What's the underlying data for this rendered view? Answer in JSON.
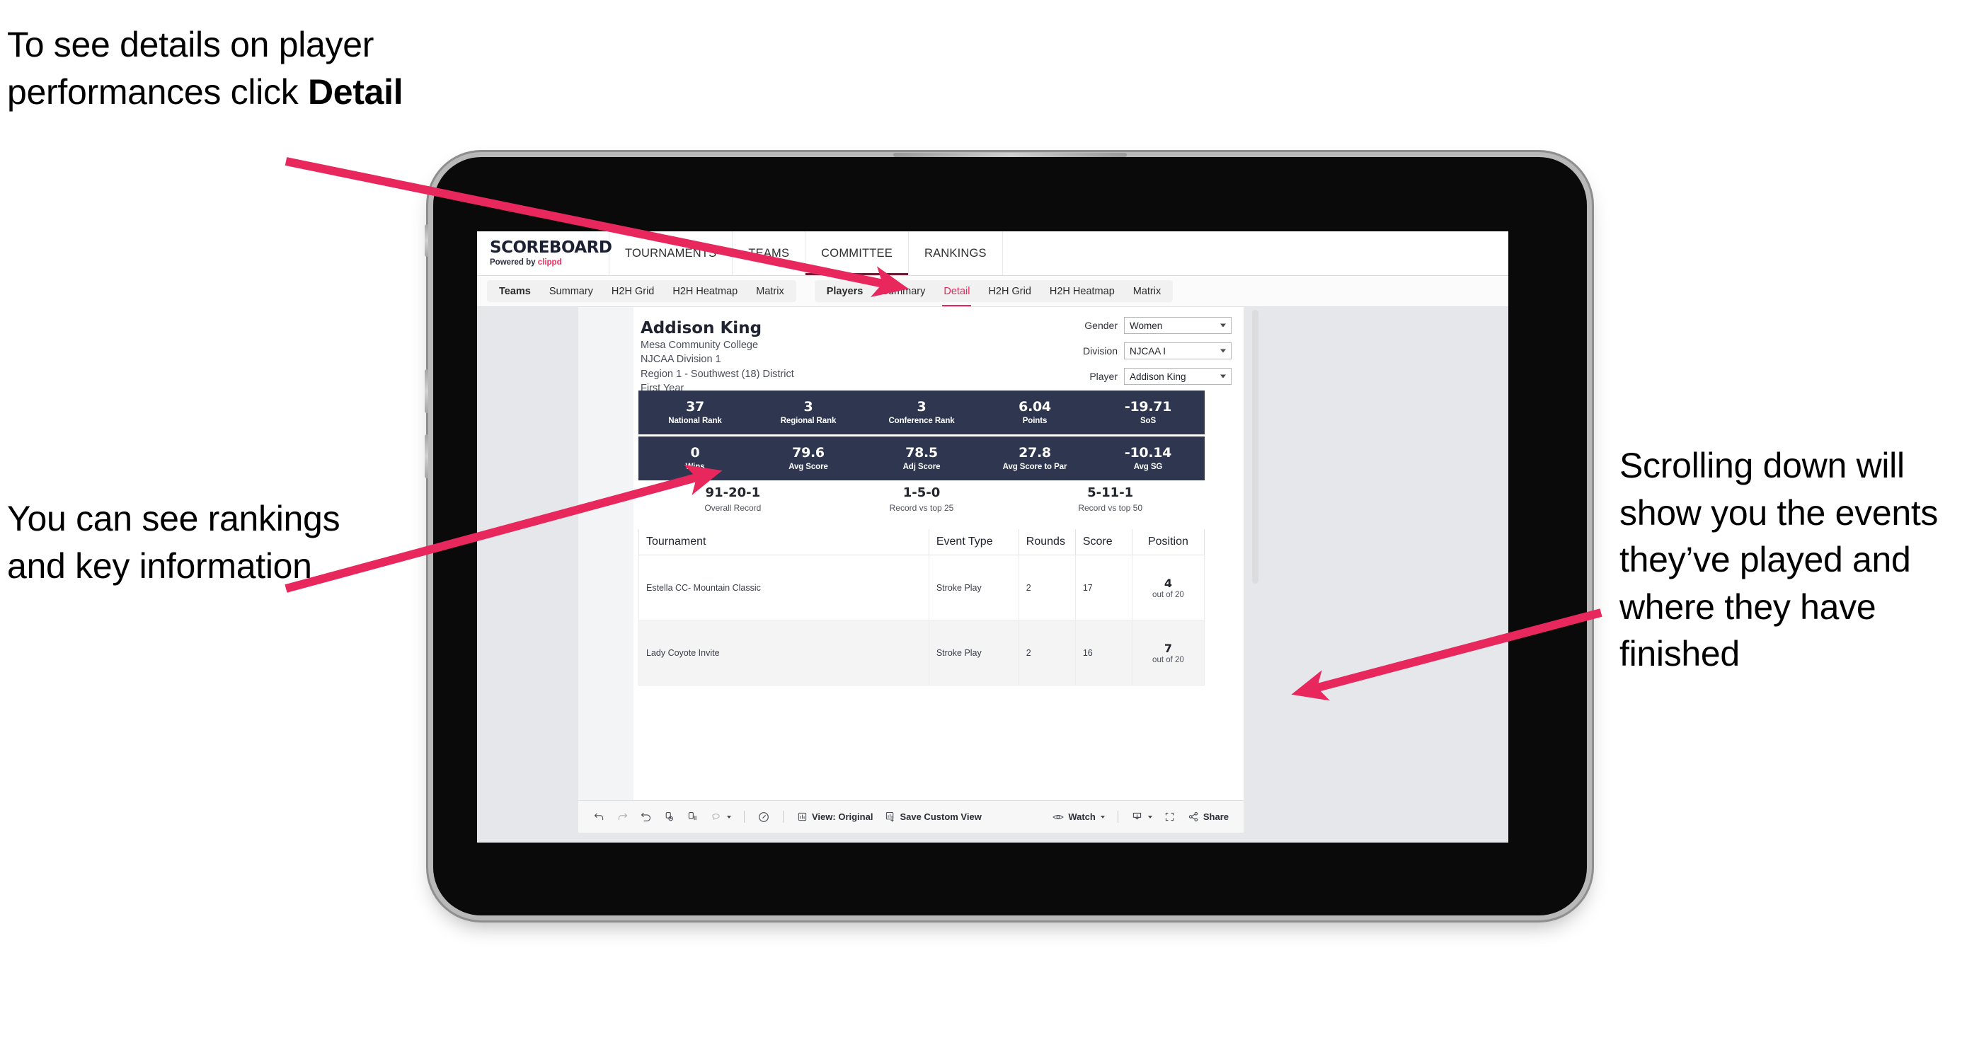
{
  "annotations": {
    "top_left": "To see details on player performances click ",
    "top_left_bold": "Detail",
    "mid_left": "You can see rankings and key information",
    "right": "Scrolling down will show you the events they’ve played and where they have finished",
    "arrow_color": "#e8275c"
  },
  "app": {
    "brand": {
      "title": "SCOREBOARD",
      "powered_prefix": "Powered by ",
      "powered_brand": "clippd"
    },
    "topnav": [
      {
        "label": "TOURNAMENTS",
        "active": false
      },
      {
        "label": "TEAMS",
        "active": false
      },
      {
        "label": "COMMITTEE",
        "active": true
      },
      {
        "label": "RANKINGS",
        "active": false
      }
    ],
    "tabs_teams": {
      "group": "Teams",
      "items": [
        {
          "label": "Summary",
          "active": false
        },
        {
          "label": "H2H Grid",
          "active": false
        },
        {
          "label": "H2H Heatmap",
          "active": false
        },
        {
          "label": "Matrix",
          "active": false
        }
      ]
    },
    "tabs_players": {
      "group": "Players",
      "items": [
        {
          "label": "Summary",
          "active": false
        },
        {
          "label": "Detail",
          "active": true
        },
        {
          "label": "H2H Grid",
          "active": false
        },
        {
          "label": "H2H Heatmap",
          "active": false
        },
        {
          "label": "Matrix",
          "active": false
        }
      ]
    }
  },
  "player": {
    "name": "Addison King",
    "school": "Mesa Community College",
    "division": "NJCAA Division 1",
    "region": "Region 1 - Southwest (18) District",
    "year": "First Year"
  },
  "filters": [
    {
      "label": "Gender",
      "value": "Women"
    },
    {
      "label": "Division",
      "value": "NJCAA I"
    },
    {
      "label": "Player",
      "value": "Addison King"
    }
  ],
  "stats_row1": [
    {
      "value": "37",
      "label": "National Rank"
    },
    {
      "value": "3",
      "label": "Regional Rank"
    },
    {
      "value": "3",
      "label": "Conference Rank"
    },
    {
      "value": "6.04",
      "label": "Points"
    },
    {
      "value": "-19.71",
      "label": "SoS"
    }
  ],
  "stats_row2": [
    {
      "value": "0",
      "label": "Wins"
    },
    {
      "value": "79.6",
      "label": "Avg Score"
    },
    {
      "value": "78.5",
      "label": "Adj Score"
    },
    {
      "value": "27.8",
      "label": "Avg Score to Par"
    },
    {
      "value": "-10.14",
      "label": "Avg SG"
    }
  ],
  "records": [
    {
      "value": "91-20-1",
      "label": "Overall Record"
    },
    {
      "value": "1-5-0",
      "label": "Record vs top 25"
    },
    {
      "value": "5-11-1",
      "label": "Record vs top 50"
    }
  ],
  "tournaments": {
    "columns": [
      "Tournament",
      "Event Type",
      "Rounds",
      "Score",
      "Position"
    ],
    "rows": [
      {
        "tournament": "Estella CC- Mountain Classic",
        "event_type": "Stroke Play",
        "rounds": "2",
        "score": "17",
        "position": "4",
        "position_of": "out of 20"
      },
      {
        "tournament": "Lady Coyote Invite",
        "event_type": "Stroke Play",
        "rounds": "2",
        "score": "16",
        "position": "7",
        "position_of": "out of 20"
      }
    ]
  },
  "toolbar": {
    "view_label": "View: Original",
    "save_label": "Save Custom View",
    "watch_label": "Watch",
    "share_label": "Share"
  },
  "colors": {
    "accent_pink": "#e8275c",
    "stat_navy": "#2e3650",
    "brand_navy": "#1b2133"
  }
}
